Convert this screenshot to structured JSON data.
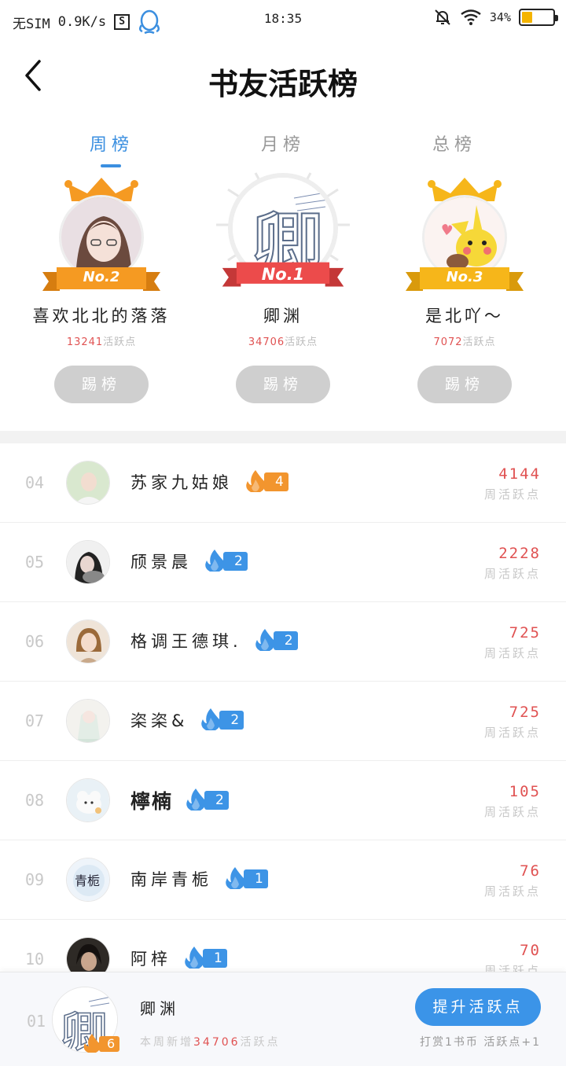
{
  "status_bar": {
    "carrier": "无SIM",
    "speed": "0.9K/s",
    "s_icon_text": "S",
    "time": "18:35",
    "battery": "34%",
    "battery_level": 0.34
  },
  "header": {
    "title": "书友活跃榜"
  },
  "tabs": [
    {
      "label": "周榜",
      "active": true
    },
    {
      "label": "月榜",
      "active": false
    },
    {
      "label": "总榜",
      "active": false
    }
  ],
  "podium": [
    {
      "rank_label": "No.2",
      "name": "喜欢北北的落落",
      "score": "13241",
      "score_suffix": "活跃点",
      "button": "踢榜",
      "ribbon_color": "#f59a22",
      "crown_color": "#f59a22"
    },
    {
      "rank_label": "No.1",
      "name": "卿渊",
      "score": "34706",
      "score_suffix": "活跃点",
      "button": "踢榜",
      "ribbon_color": "#ec4b4b",
      "crown_color": "#ec4b4b"
    },
    {
      "rank_label": "No.3",
      "name": "是北吖～",
      "score": "7072",
      "score_suffix": "活跃点",
      "button": "踢榜",
      "ribbon_color": "#f6b61a",
      "crown_color": "#f6b61a"
    }
  ],
  "list": [
    {
      "rank": "04",
      "name": "苏家九姑娘",
      "level": "4",
      "level_color": "orange",
      "score": "4144",
      "label": "周活跃点",
      "bold": false
    },
    {
      "rank": "05",
      "name": "颀景晨",
      "level": "2",
      "level_color": "blue",
      "score": "2228",
      "label": "周活跃点",
      "bold": false
    },
    {
      "rank": "06",
      "name": "格调王德琪.",
      "level": "2",
      "level_color": "blue",
      "score": "725",
      "label": "周活跃点",
      "bold": false
    },
    {
      "rank": "07",
      "name": "栥栥&",
      "level": "2",
      "level_color": "blue",
      "score": "725",
      "label": "周活跃点",
      "bold": false
    },
    {
      "rank": "08",
      "name": "檸楠",
      "level": "2",
      "level_color": "blue",
      "score": "105",
      "label": "周活跃点",
      "bold": true
    },
    {
      "rank": "09",
      "name": "南岸青栀",
      "level": "1",
      "level_color": "blue",
      "score": "76",
      "label": "周活跃点",
      "bold": false
    },
    {
      "rank": "10",
      "name": "阿梓",
      "level": "1",
      "level_color": "blue",
      "score": "70",
      "label": "周活跃点",
      "bold": false
    }
  ],
  "me": {
    "rank": "01",
    "name": "卿渊",
    "level": "6",
    "sub_prefix": "本周新增",
    "sub_value": "34706",
    "sub_suffix": "活跃点",
    "button": "提升活跃点",
    "tip": "打赏1书币 活跃点+1"
  },
  "colors": {
    "accent": "#3b8fe0",
    "score_red": "#e05252",
    "muted": "#c8c8c8"
  }
}
